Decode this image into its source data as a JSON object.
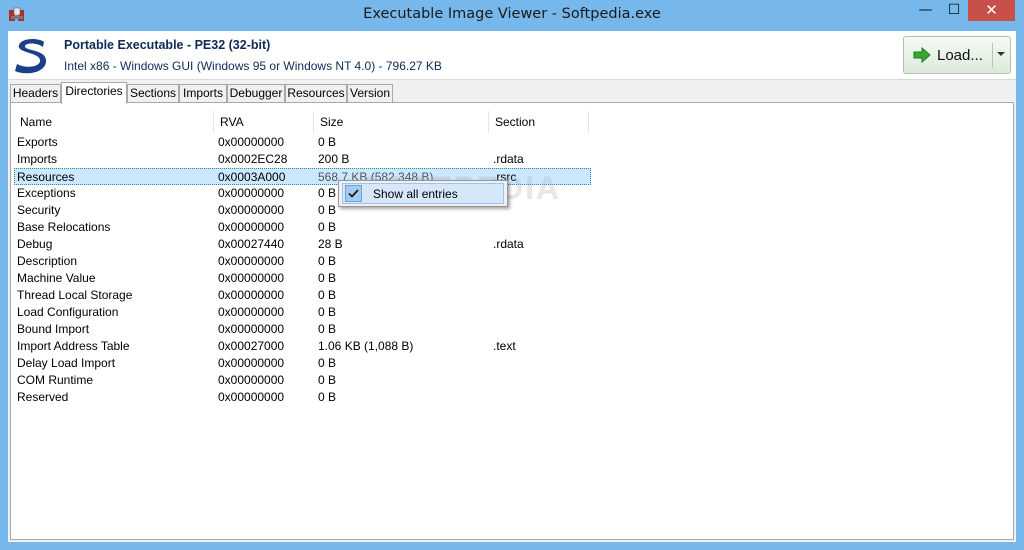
{
  "window": {
    "title": "Executable Image Viewer - Softpedia.exe",
    "controls": {
      "minimize": "—",
      "maximize": "☐",
      "close": "✕"
    }
  },
  "header": {
    "file_type": "Portable Executable - PE32 (32-bit)",
    "file_info": "Intel x86 - Windows GUI (Windows 95 or Windows NT 4.0) - 796.27 KB",
    "load_button": "Load..."
  },
  "tabs": [
    {
      "label": "Headers",
      "active": false
    },
    {
      "label": "Directories",
      "active": true
    },
    {
      "label": "Sections",
      "active": false
    },
    {
      "label": "Imports",
      "active": false
    },
    {
      "label": "Debugger",
      "active": false
    },
    {
      "label": "Resources",
      "active": false
    },
    {
      "label": "Version",
      "active": false
    }
  ],
  "table": {
    "columns": [
      "Name",
      "RVA",
      "Size",
      "Section"
    ],
    "rows": [
      {
        "name": "Exports",
        "rva": "0x00000000",
        "size": "0 B",
        "section": ""
      },
      {
        "name": "Imports",
        "rva": "0x0002EC28",
        "size": "200 B",
        "section": ".rdata"
      },
      {
        "name": "Resources",
        "rva": "0x0003A000",
        "size": "568.7 KB (582,348 B)",
        "section": ".rsrc",
        "selected": true
      },
      {
        "name": "Exceptions",
        "rva": "0x00000000",
        "size": "0 B",
        "section": ""
      },
      {
        "name": "Security",
        "rva": "0x00000000",
        "size": "0 B",
        "section": ""
      },
      {
        "name": "Base Relocations",
        "rva": "0x00000000",
        "size": "0 B",
        "section": ""
      },
      {
        "name": "Debug",
        "rva": "0x00027440",
        "size": "28 B",
        "section": ".rdata"
      },
      {
        "name": "Description",
        "rva": "0x00000000",
        "size": "0 B",
        "section": ""
      },
      {
        "name": "Machine Value",
        "rva": "0x00000000",
        "size": "0 B",
        "section": ""
      },
      {
        "name": "Thread Local Storage",
        "rva": "0x00000000",
        "size": "0 B",
        "section": ""
      },
      {
        "name": "Load Configuration",
        "rva": "0x00000000",
        "size": "0 B",
        "section": ""
      },
      {
        "name": "Bound Import",
        "rva": "0x00000000",
        "size": "0 B",
        "section": ""
      },
      {
        "name": "Import Address Table",
        "rva": "0x00027000",
        "size": "1.06 KB (1,088 B)",
        "section": ".text"
      },
      {
        "name": "Delay Load Import",
        "rva": "0x00000000",
        "size": "0 B",
        "section": ""
      },
      {
        "name": "COM Runtime",
        "rva": "0x00000000",
        "size": "0 B",
        "section": ""
      },
      {
        "name": "Reserved",
        "rva": "0x00000000",
        "size": "0 B",
        "section": ""
      }
    ]
  },
  "context_menu": {
    "items": [
      {
        "label": "Show all entries",
        "checked": true
      }
    ]
  },
  "watermark": "SOFTPEDIA",
  "colors": {
    "titlebar": "#76b7ec",
    "close_button": "#c7504a",
    "selection": "#cce8ff",
    "header_text": "#0f2a56",
    "logo": "#1c3f8a",
    "load_arrow": "#36a832"
  }
}
